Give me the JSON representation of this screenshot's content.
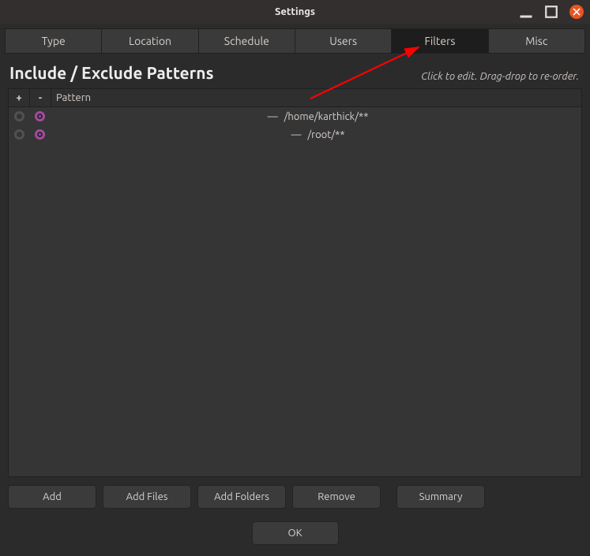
{
  "window": {
    "title": "Settings"
  },
  "tabs": [
    {
      "id": "type",
      "label": "Type",
      "active": false
    },
    {
      "id": "location",
      "label": "Location",
      "active": false
    },
    {
      "id": "schedule",
      "label": "Schedule",
      "active": false
    },
    {
      "id": "users",
      "label": "Users",
      "active": false
    },
    {
      "id": "filters",
      "label": "Filters",
      "active": true
    },
    {
      "id": "misc",
      "label": "Misc",
      "active": false
    }
  ],
  "page": {
    "heading": "Include / Exclude Patterns",
    "hint": "Click to edit. Drag-drop to re-order."
  },
  "table": {
    "head_plus": "+",
    "head_minus": "-",
    "head_pattern": "Pattern",
    "rows": [
      {
        "include": false,
        "exclude": true,
        "pattern": "/home/karthick/**"
      },
      {
        "include": false,
        "exclude": true,
        "pattern": "/root/**"
      }
    ]
  },
  "em_dash": "—",
  "buttons": {
    "add": "Add",
    "add_files": "Add Files",
    "add_folders": "Add Folders",
    "remove": "Remove",
    "summary": "Summary",
    "ok": "OK"
  }
}
